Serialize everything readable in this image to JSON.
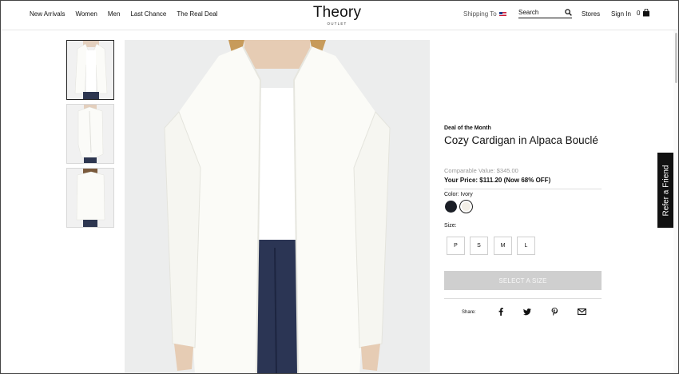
{
  "header": {
    "nav": [
      "New Arrivals",
      "Women",
      "Men",
      "Last Chance",
      "The Real Deal"
    ],
    "logo": {
      "main": "Theory",
      "sub": "OUTLET"
    },
    "shipping_label": "Shipping To",
    "shipping_flag": "us-flag-icon",
    "search_placeholder": "Search",
    "stores_label": "Stores",
    "signin_label": "Sign In",
    "cart_count": "0"
  },
  "gallery": {
    "thumbnails": [
      "front view",
      "side view",
      "back view"
    ],
    "selected_index": 0
  },
  "product": {
    "badge": "Deal of the Month",
    "name": "Cozy Cardigan in Alpaca Bouclé",
    "comparable_value": "Comparable Value: $345.00",
    "your_price": "Your Price: $111.20 (Now 68% OFF)",
    "color_label": "Color:",
    "selected_color": "Ivory",
    "colors": [
      {
        "name": "Navy",
        "hex": "#1b1e26"
      },
      {
        "name": "Ivory",
        "hex": "#f3efe7"
      }
    ],
    "size_label": "Size:",
    "sizes": [
      "P",
      "S",
      "M",
      "L"
    ],
    "select_button": "SELECT A SIZE",
    "share_label": "Share:",
    "share_icons": [
      "facebook-icon",
      "twitter-icon",
      "pinterest-icon",
      "email-icon"
    ]
  },
  "refer_tab": "Refer a Friend",
  "colors": {
    "select_disabled": "#cfcfcf",
    "image_bg": "#eceded",
    "text": "#111111"
  }
}
